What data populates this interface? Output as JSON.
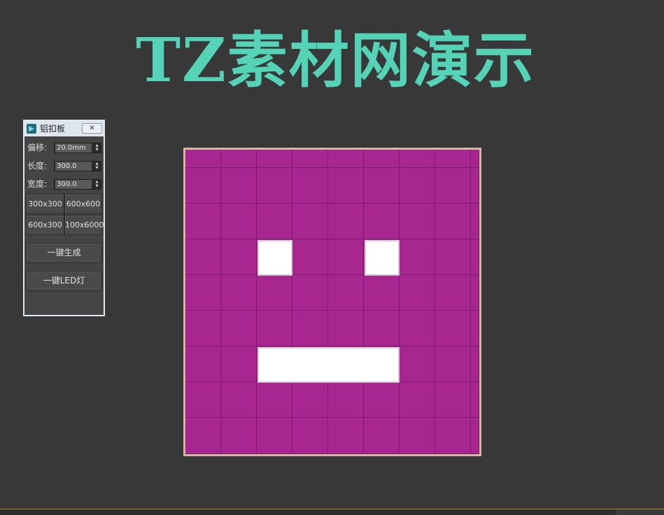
{
  "banner": {
    "title": "TZ素材网演示",
    "color": "#55d3b6"
  },
  "panel": {
    "title": "铝扣板",
    "close_glyph": "✕",
    "fields": [
      {
        "label": "偏移:",
        "value": "20.0mm"
      },
      {
        "label": "长度:",
        "value": "300.0"
      },
      {
        "label": "宽度:",
        "value": "300.0"
      }
    ],
    "spinner_glyph": "▲▼",
    "preset_buttons": [
      "300x300",
      "600x600",
      "600x300",
      "100x6000"
    ],
    "generate_button": "一键生成",
    "led_button": "一键LED灯"
  },
  "grid": {
    "cell_color": "#a8268f",
    "line_color": "#7e1a6d",
    "border_color": "#d4b79f",
    "window_color": "#ffffff"
  },
  "colors": {
    "background": "#383838",
    "accent_line": "#b0802f"
  }
}
